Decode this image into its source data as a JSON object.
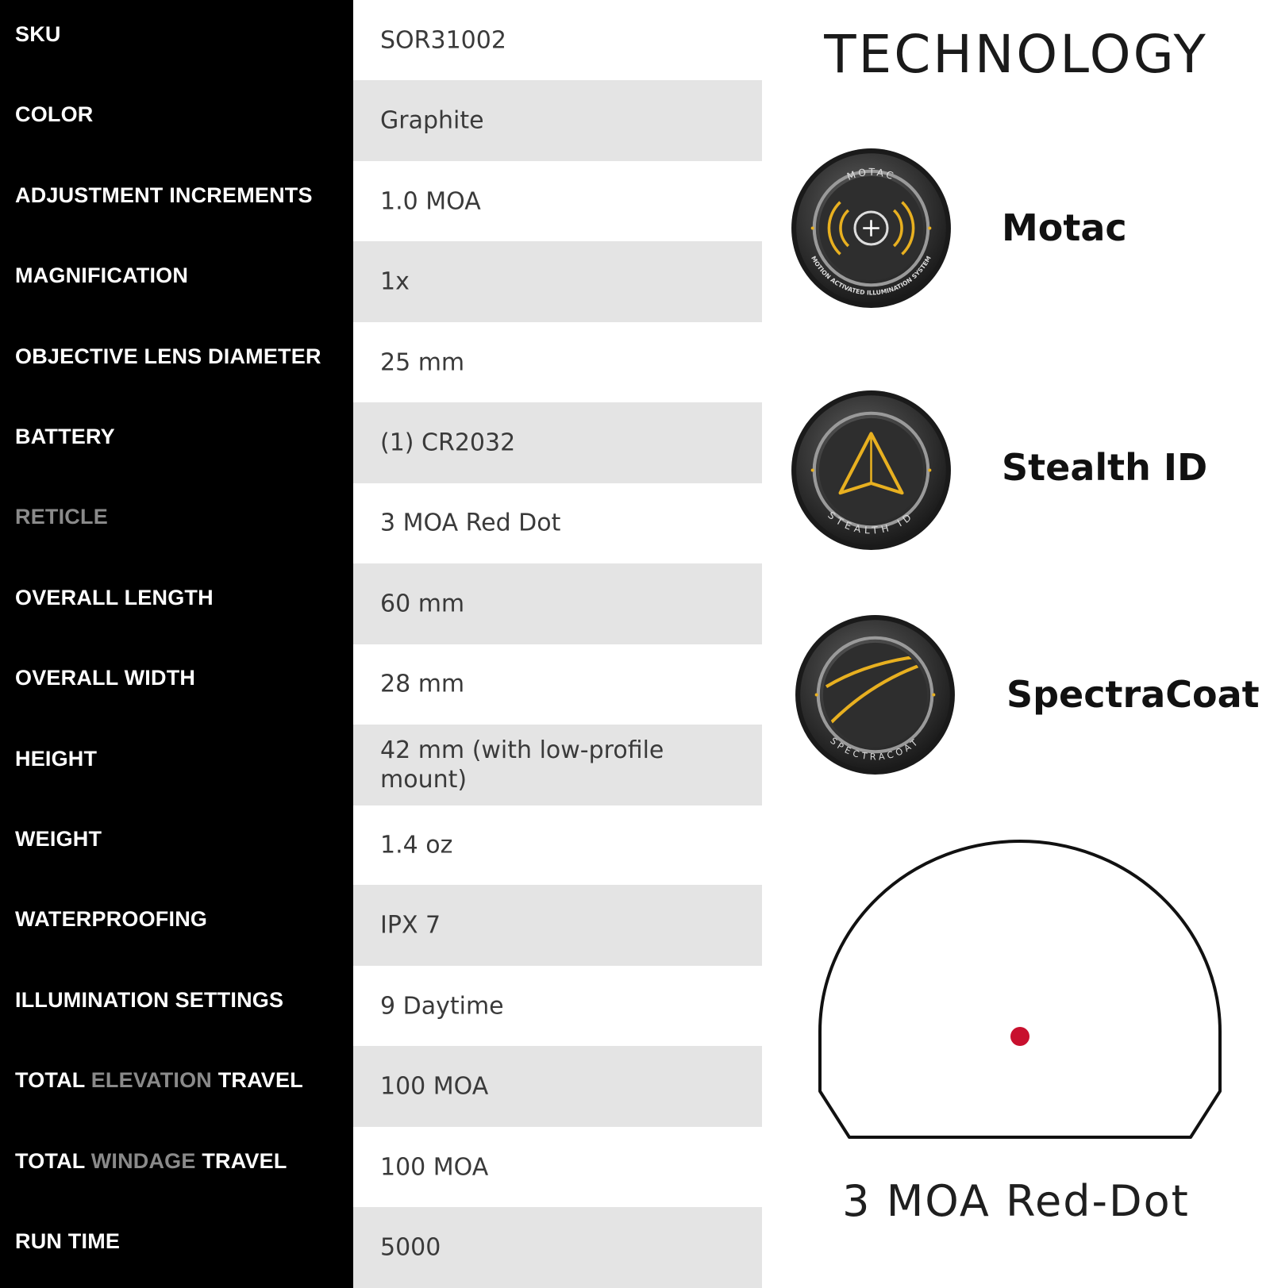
{
  "specs": [
    {
      "label": "SKU",
      "value": "SOR31002"
    },
    {
      "label": "COLOR",
      "value": "Graphite"
    },
    {
      "label": "ADJUSTMENT INCREMENTS",
      "value": "1.0 MOA"
    },
    {
      "label": "MAGNIFICATION",
      "value": "1x"
    },
    {
      "label": "OBJECTIVE LENS DIAMETER",
      "value": "25 mm"
    },
    {
      "label": "BATTERY",
      "value": "(1) CR2032"
    },
    {
      "label": "RETICLE",
      "value": "3 MOA Red Dot"
    },
    {
      "label": "OVERALL LENGTH",
      "value": "60 mm"
    },
    {
      "label": "OVERALL WIDTH",
      "value": "28 mm"
    },
    {
      "label": "HEIGHT",
      "value": "42 mm (with low-profile mount)"
    },
    {
      "label": "WEIGHT",
      "value": "1.4 oz"
    },
    {
      "label": "WATERPROOFING",
      "value": "IPX 7"
    },
    {
      "label": "ILLUMINATION SETTINGS",
      "value": "9 Daytime"
    },
    {
      "label_parts": [
        "TOTAL",
        "ELEVATION",
        "TRAVEL"
      ],
      "value": "100 MOA"
    },
    {
      "label_parts": [
        "TOTAL",
        "WINDAGE",
        "TRAVEL"
      ],
      "value": "100 MOA"
    },
    {
      "label": "RUN TIME",
      "value": "5000"
    }
  ],
  "technology": {
    "title": "TECHNOLOGY",
    "items": [
      {
        "name": "Motac",
        "icon": "motac-icon",
        "ring_text": "MOTAC",
        "ring_subtext": "MOTION ACTIVATED ILLUMINATION SYSTEM"
      },
      {
        "name": "Stealth ID",
        "icon": "stealth-id-icon",
        "ring_text": "STEALTH ID"
      },
      {
        "name": "SpectraCoat",
        "icon": "spectracoat-icon",
        "ring_text": "SPECTRACOAT"
      }
    ]
  },
  "reticle": {
    "caption": "3 MOA Red-Dot",
    "dot_color": "#c8102e"
  },
  "colors": {
    "label_bg": "#000000",
    "label_text": "#ffffff",
    "label_dim_text": "#8a8a8a",
    "row_shade": "#e4e4e4",
    "accent_gold": "#e8b020"
  }
}
